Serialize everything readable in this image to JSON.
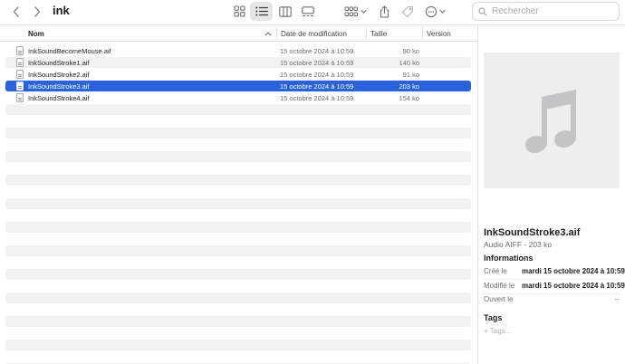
{
  "window": {
    "title": "ink"
  },
  "toolbar": {
    "search_placeholder": "Rechercher",
    "buttons": [
      {
        "name": "back",
        "icon": "chevron-left-icon"
      },
      {
        "name": "forward",
        "icon": "chevron-right-icon"
      },
      {
        "name": "view-icons",
        "icon": "grid-icon"
      },
      {
        "name": "view-list",
        "icon": "list-icon",
        "active": true
      },
      {
        "name": "view-columns",
        "icon": "columns-icon"
      },
      {
        "name": "view-gallery",
        "icon": "gallery-icon"
      },
      {
        "name": "group",
        "icon": "group-icon"
      },
      {
        "name": "share",
        "icon": "share-icon"
      },
      {
        "name": "tag",
        "icon": "tag-icon"
      },
      {
        "name": "more",
        "icon": "ellipsis-circle-icon"
      }
    ]
  },
  "list": {
    "columns": {
      "name": "Nom",
      "date": "Date de modification",
      "size": "Taille",
      "version": "Version"
    },
    "files": [
      {
        "name": "InkSoundBecomeMouse.aif",
        "date": "15 octobre 2024 à 10:59",
        "size": "90 ko",
        "selected": false
      },
      {
        "name": "InkSoundStroke1.aif",
        "date": "15 octobre 2024 à 10:59",
        "size": "140 ko",
        "selected": false
      },
      {
        "name": "InkSoundStroke2.aif",
        "date": "15 octobre 2024 à 10:59",
        "size": "91 ko",
        "selected": false
      },
      {
        "name": "InkSoundStroke3.aif",
        "date": "15 octobre 2024 à 10:59",
        "size": "203 ko",
        "selected": true
      },
      {
        "name": "InkSoundStroke4.aif",
        "date": "15 octobre 2024 à 10:59",
        "size": "154 ko",
        "selected": false
      }
    ]
  },
  "preview": {
    "icon": "music-note-icon",
    "file_name": "InkSoundStroke3.aif",
    "kind": "Audio AIFF - 203 ko",
    "info_title": "Informations",
    "created_label": "Créé le",
    "created_value": "mardi 15 octobre 2024 à 10:59",
    "modified_label": "Modifié le",
    "modified_value": "mardi 15 octobre 2024 à 10:59",
    "opened_label": "Ouvert le",
    "opened_value": "--",
    "tags_title": "Tags",
    "add_tags": "+ Tags..."
  },
  "colors": {
    "selection": "#2a63d9",
    "stripe": "#f2f2f3",
    "icon_gray": "#6e6e73"
  }
}
